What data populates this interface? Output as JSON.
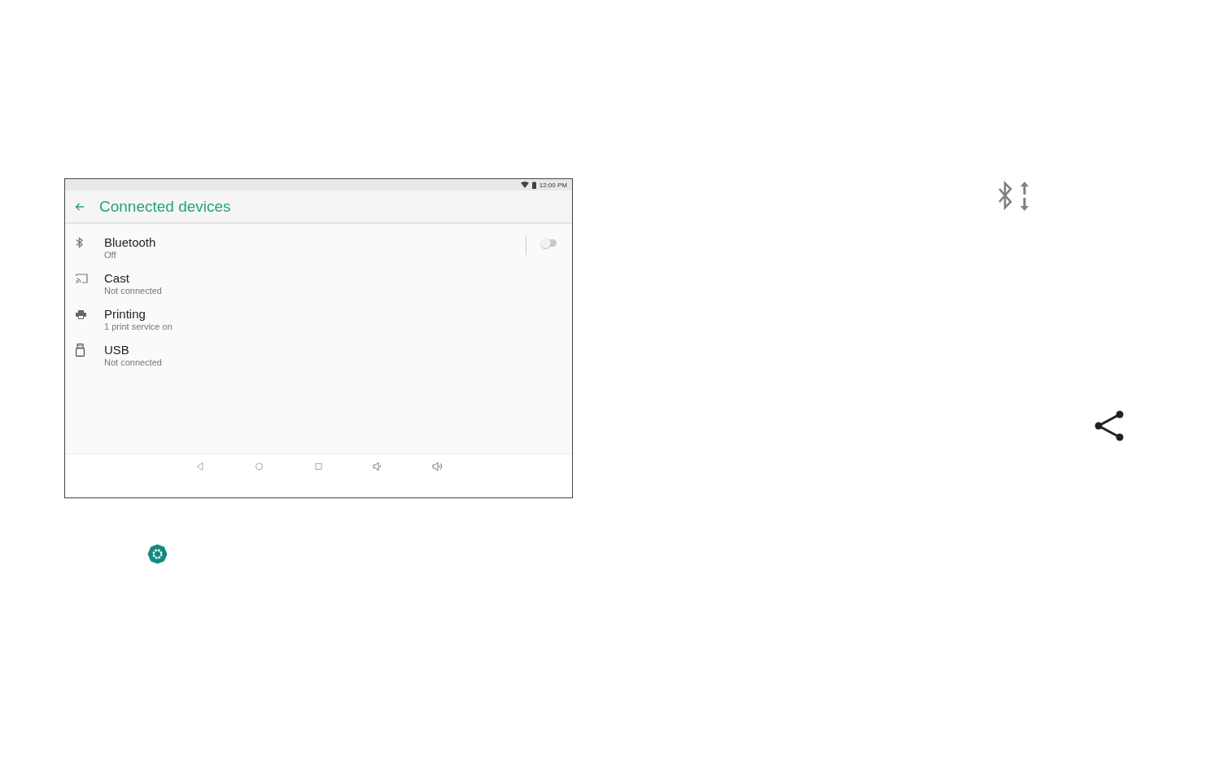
{
  "status_bar": {
    "time": "12:00 PM"
  },
  "toolbar": {
    "title": "Connected devices"
  },
  "settings": [
    {
      "title": "Bluetooth",
      "subtitle": "Off",
      "toggle": {
        "on": false
      }
    },
    {
      "title": "Cast",
      "subtitle": "Not connected"
    },
    {
      "title": "Printing",
      "subtitle": "1 print service on"
    },
    {
      "title": "USB",
      "subtitle": "Not connected"
    }
  ]
}
